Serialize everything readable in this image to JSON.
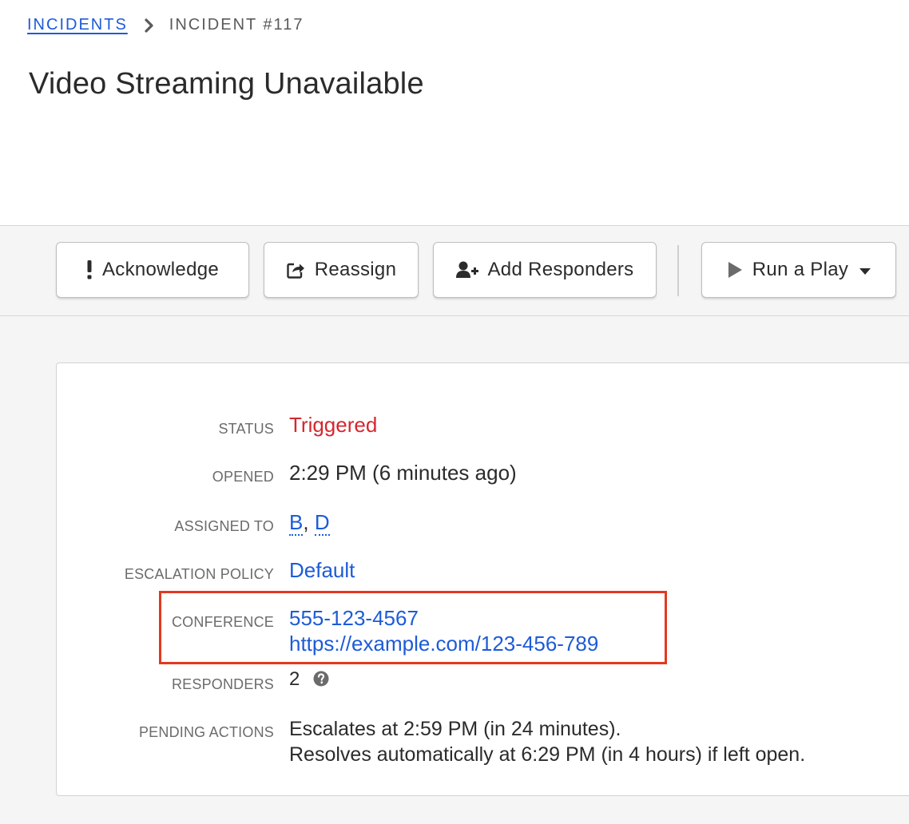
{
  "breadcrumb": {
    "parent_label": "INCIDENTS",
    "current_label": "INCIDENT #117"
  },
  "incident": {
    "title": "Video Streaming Unavailable"
  },
  "toolbar": {
    "acknowledge_label": "Acknowledge",
    "reassign_label": "Reassign",
    "add_responders_label": "Add Responders",
    "run_play_label": "Run a Play",
    "icons": {
      "acknowledge": "exclamation-icon",
      "reassign": "share-icon",
      "add_responders": "user-plus-icon",
      "run_play": "play-icon",
      "dropdown": "caret-down-icon"
    }
  },
  "details": {
    "status": {
      "label": "STATUS",
      "value": "Triggered",
      "color": "#d4272e"
    },
    "opened": {
      "label": "OPENED",
      "value": "2:29 PM (6 minutes ago)"
    },
    "assigned_to": {
      "label": "ASSIGNED TO",
      "users": [
        "B",
        "D"
      ],
      "separator": ","
    },
    "escalation_policy": {
      "label": "ESCALATION POLICY",
      "value": "Default"
    },
    "conference": {
      "label": "CONFERENCE",
      "phone": "555-123-4567",
      "url": "https://example.com/123-456-789",
      "highlight_color": "#e2391f"
    },
    "responders": {
      "label": "RESPONDERS",
      "value": "2",
      "icon": "question-circle-icon"
    },
    "pending_actions": {
      "label": "PENDING ACTIONS",
      "lines": [
        "Escalates at 2:59 PM (in 24 minutes).",
        "Resolves automatically at 6:29 PM (in 4 hours) if left open."
      ]
    }
  },
  "colors": {
    "link": "#1d5bd8",
    "status_triggered": "#d4272e",
    "highlight": "#e2391f"
  }
}
